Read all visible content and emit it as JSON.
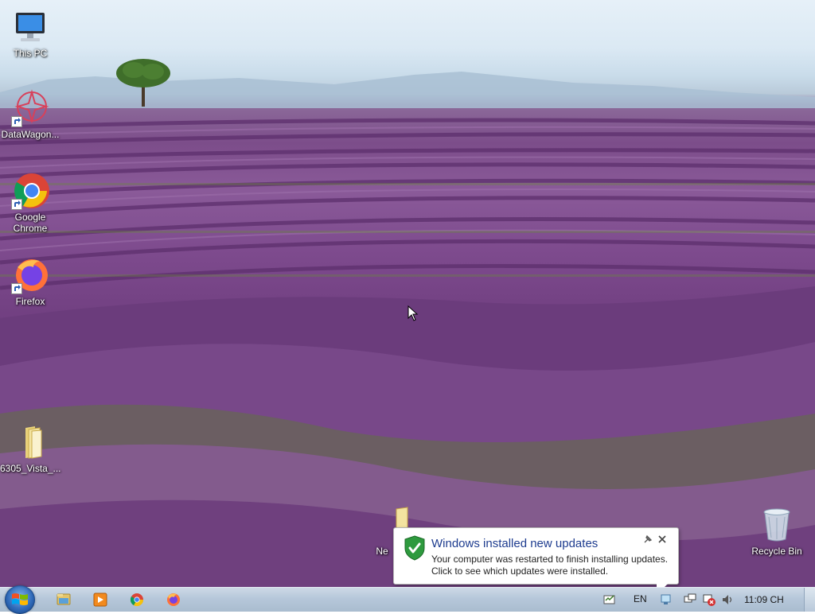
{
  "desktop": {
    "icons": [
      {
        "label": "This PC",
        "icon": "computer-icon"
      },
      {
        "label": "DataWagon...",
        "icon": "datawagon-icon"
      },
      {
        "label": "Google Chrome",
        "icon": "chrome-icon"
      },
      {
        "label": "Firefox",
        "icon": "firefox-icon"
      },
      {
        "label": "6305_Vista_...",
        "icon": "folder-icon"
      },
      {
        "label": "Ne",
        "icon": "folder-icon"
      },
      {
        "label": "Recycle Bin",
        "icon": "recycle-bin-icon"
      }
    ]
  },
  "notification": {
    "title": "Windows installed new updates",
    "line1": "Your computer was restarted to finish installing updates.",
    "line2": "Click to see which updates were installed.",
    "icon": "shield-check-icon"
  },
  "taskbar": {
    "pinned": [
      "explorer-icon",
      "media-player-icon",
      "chrome-icon",
      "firefox-icon"
    ],
    "language": "EN",
    "clock": "11:09 CH",
    "tray_icons": [
      "action-center-icon",
      "network-icon",
      "network-error-icon",
      "volume-icon"
    ]
  },
  "colors": {
    "balloon_title": "#1e3c8f",
    "taskbar": "#b6c7da"
  }
}
